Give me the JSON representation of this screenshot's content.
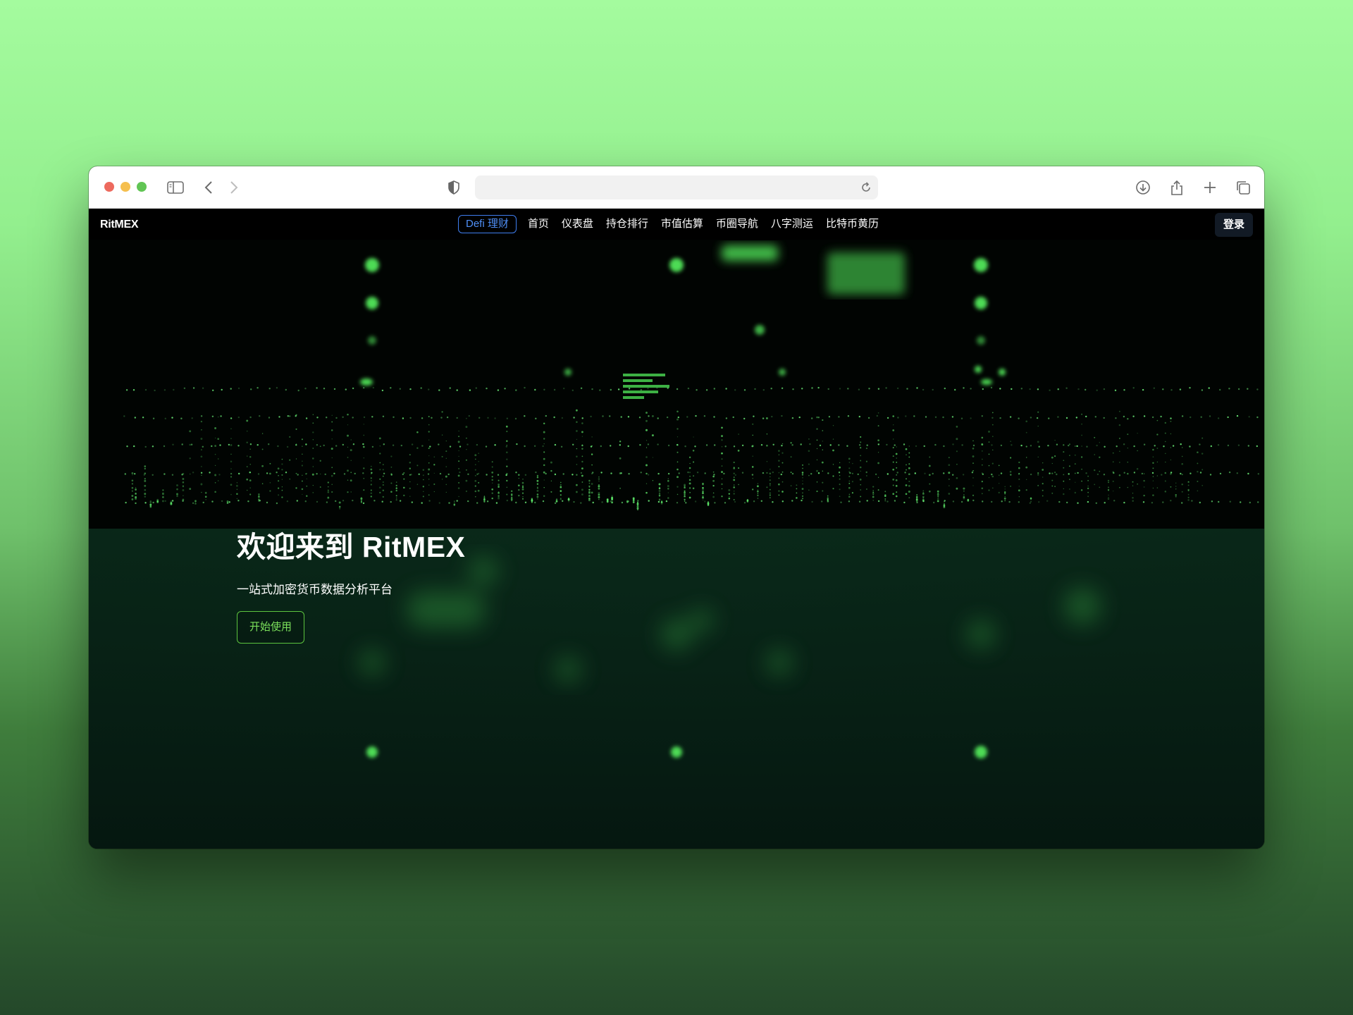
{
  "browser": {
    "icons": [
      "sidebar-icon",
      "back-chevron-icon",
      "forward-chevron-icon",
      "shield-icon",
      "reload-icon",
      "download-icon",
      "share-icon",
      "new-tab-icon",
      "tabs-overview-icon"
    ],
    "address_value": ""
  },
  "site": {
    "logo": "RitMEX",
    "nav": {
      "defi": "Defi 理财",
      "items": [
        "首页",
        "仪表盘",
        "持仓排行",
        "市值估算",
        "币圈导航",
        "八字测运",
        "比特币黄历"
      ]
    },
    "login": "登录",
    "hero": {
      "title": "欢迎来到 RitMEX",
      "subtitle": "一站式加密货币数据分析平台",
      "cta": "开始使用"
    }
  },
  "colors": {
    "desktop_top": "#a4fb9e",
    "desktop_bottom": "#24482a",
    "accent_green": "#7be05b",
    "defi_blue": "#4f8ff7",
    "login_bg": "#121a25"
  }
}
